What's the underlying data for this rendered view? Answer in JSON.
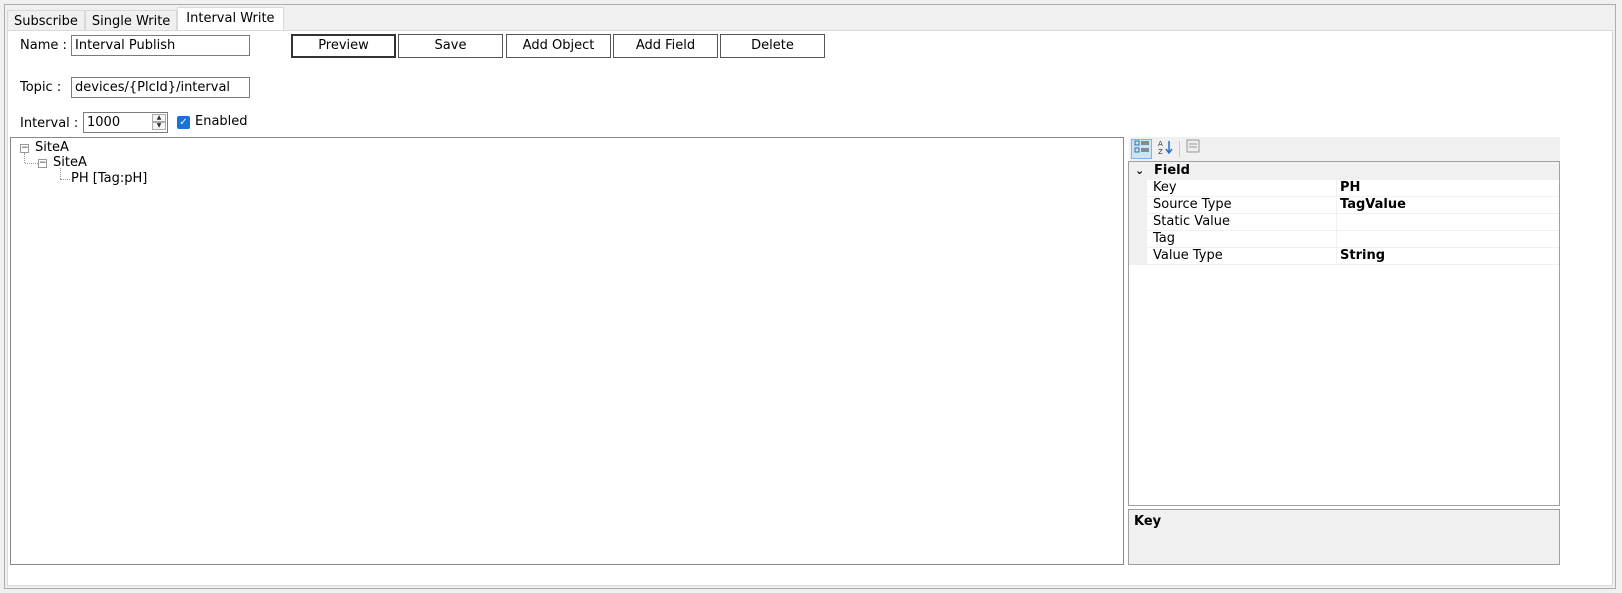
{
  "tabs": [
    "Subscribe",
    "Single Write",
    "Interval Write"
  ],
  "form": {
    "name_label": "Name :",
    "name_value": "Interval Publish",
    "topic_label": "Topic :",
    "topic_value": "devices/{PlcId}/interval",
    "interval_label": "Interval :",
    "interval_value": "1000",
    "enabled_label": "Enabled",
    "enabled_checked": true
  },
  "buttons": {
    "preview": "Preview",
    "save": "Save",
    "add_object": "Add Object",
    "add_field": "Add Field",
    "delete": "Delete"
  },
  "tree": {
    "root": "SiteA",
    "child": "SiteA",
    "leaf": "PH  [Tag:pH]"
  },
  "property_grid": {
    "category": "Field",
    "rows": [
      {
        "key": "Key",
        "value": "PH"
      },
      {
        "key": "Source Type",
        "value": "TagValue"
      },
      {
        "key": "Static Value",
        "value": ""
      },
      {
        "key": "Tag",
        "value": ""
      },
      {
        "key": "Value Type",
        "value": "String"
      }
    ],
    "help_title": "Key",
    "toolbar_icons": [
      "categorized-icon",
      "alphabetical-sort-icon",
      "property-pages-icon"
    ]
  }
}
